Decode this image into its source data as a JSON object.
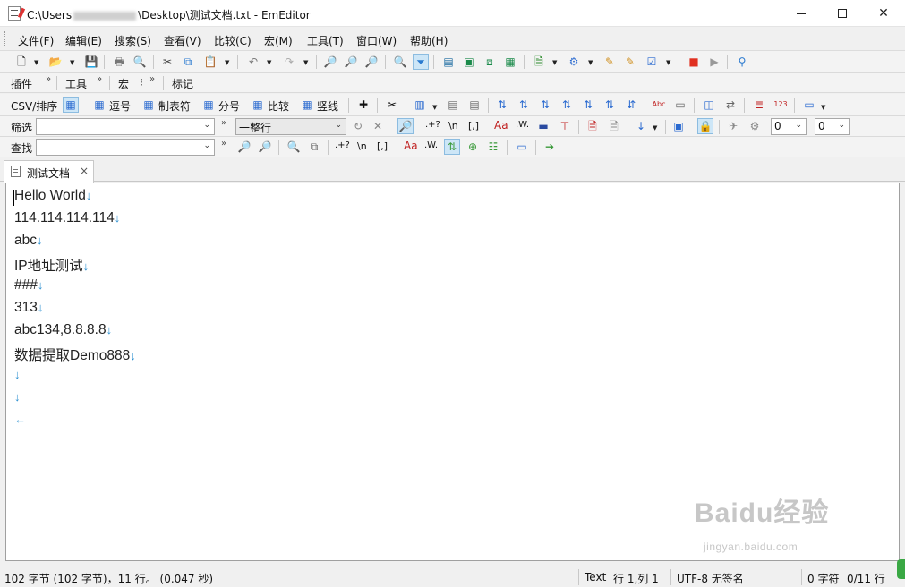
{
  "window": {
    "title_prefix": "C:\\Users",
    "title_suffix": "\\Desktop\\测试文档.txt - EmEditor",
    "controls": {
      "minimize": "—",
      "maximize": "☐",
      "close": "✕"
    }
  },
  "menu": [
    "文件(F)",
    "编辑(E)",
    "搜索(S)",
    "查看(V)",
    "比较(C)",
    "宏(M)",
    "工具(T)",
    "窗口(W)",
    "帮助(H)"
  ],
  "toolbars": {
    "plugins_label": "插件",
    "tools_label": "工具",
    "macro_label": "宏",
    "macro_suffix": "⁝",
    "marks_label": "标记",
    "more": "»",
    "csv_label": "CSV/排序",
    "csv_buttons": [
      "逗号",
      "制表符",
      "分号",
      "比较",
      "竖线"
    ],
    "filter_label": "筛选",
    "filter_value": "",
    "filter_mode": "一整行",
    "filter_num1": "0",
    "filter_num2": "0",
    "find_label": "查找",
    "find_value": "",
    "regex_label": ".+?",
    "newline_label": "\\n",
    "bracket_label": "[,]",
    "case_label": "Aa",
    "word_label": ".W."
  },
  "tab": {
    "label": "测试文档",
    "close": "×"
  },
  "editor": {
    "lines": [
      "Hello World",
      "114.114.114.114",
      "abc",
      "IP地址测试",
      "###",
      "313",
      "abc134,8.8.8.8",
      "数据提取Demo888",
      "",
      "",
      ""
    ],
    "newline_mark": "↓",
    "eof_mark": "←"
  },
  "watermark": {
    "brand": "Baidu经验",
    "url": "jingyan.baidu.com"
  },
  "status": {
    "summary": "102 字节 (102 字节)，11 行。 (0.047 秒)",
    "mode": "Text",
    "position": "行 1,列 1",
    "encoding": "UTF-8 无签名",
    "selection": "0 字符",
    "matches": "0/11 行"
  },
  "colors": {
    "newline_mark": "#2a8fd0",
    "editor_bg": "#ffffff",
    "chrome_bg": "#f0f0f0"
  }
}
